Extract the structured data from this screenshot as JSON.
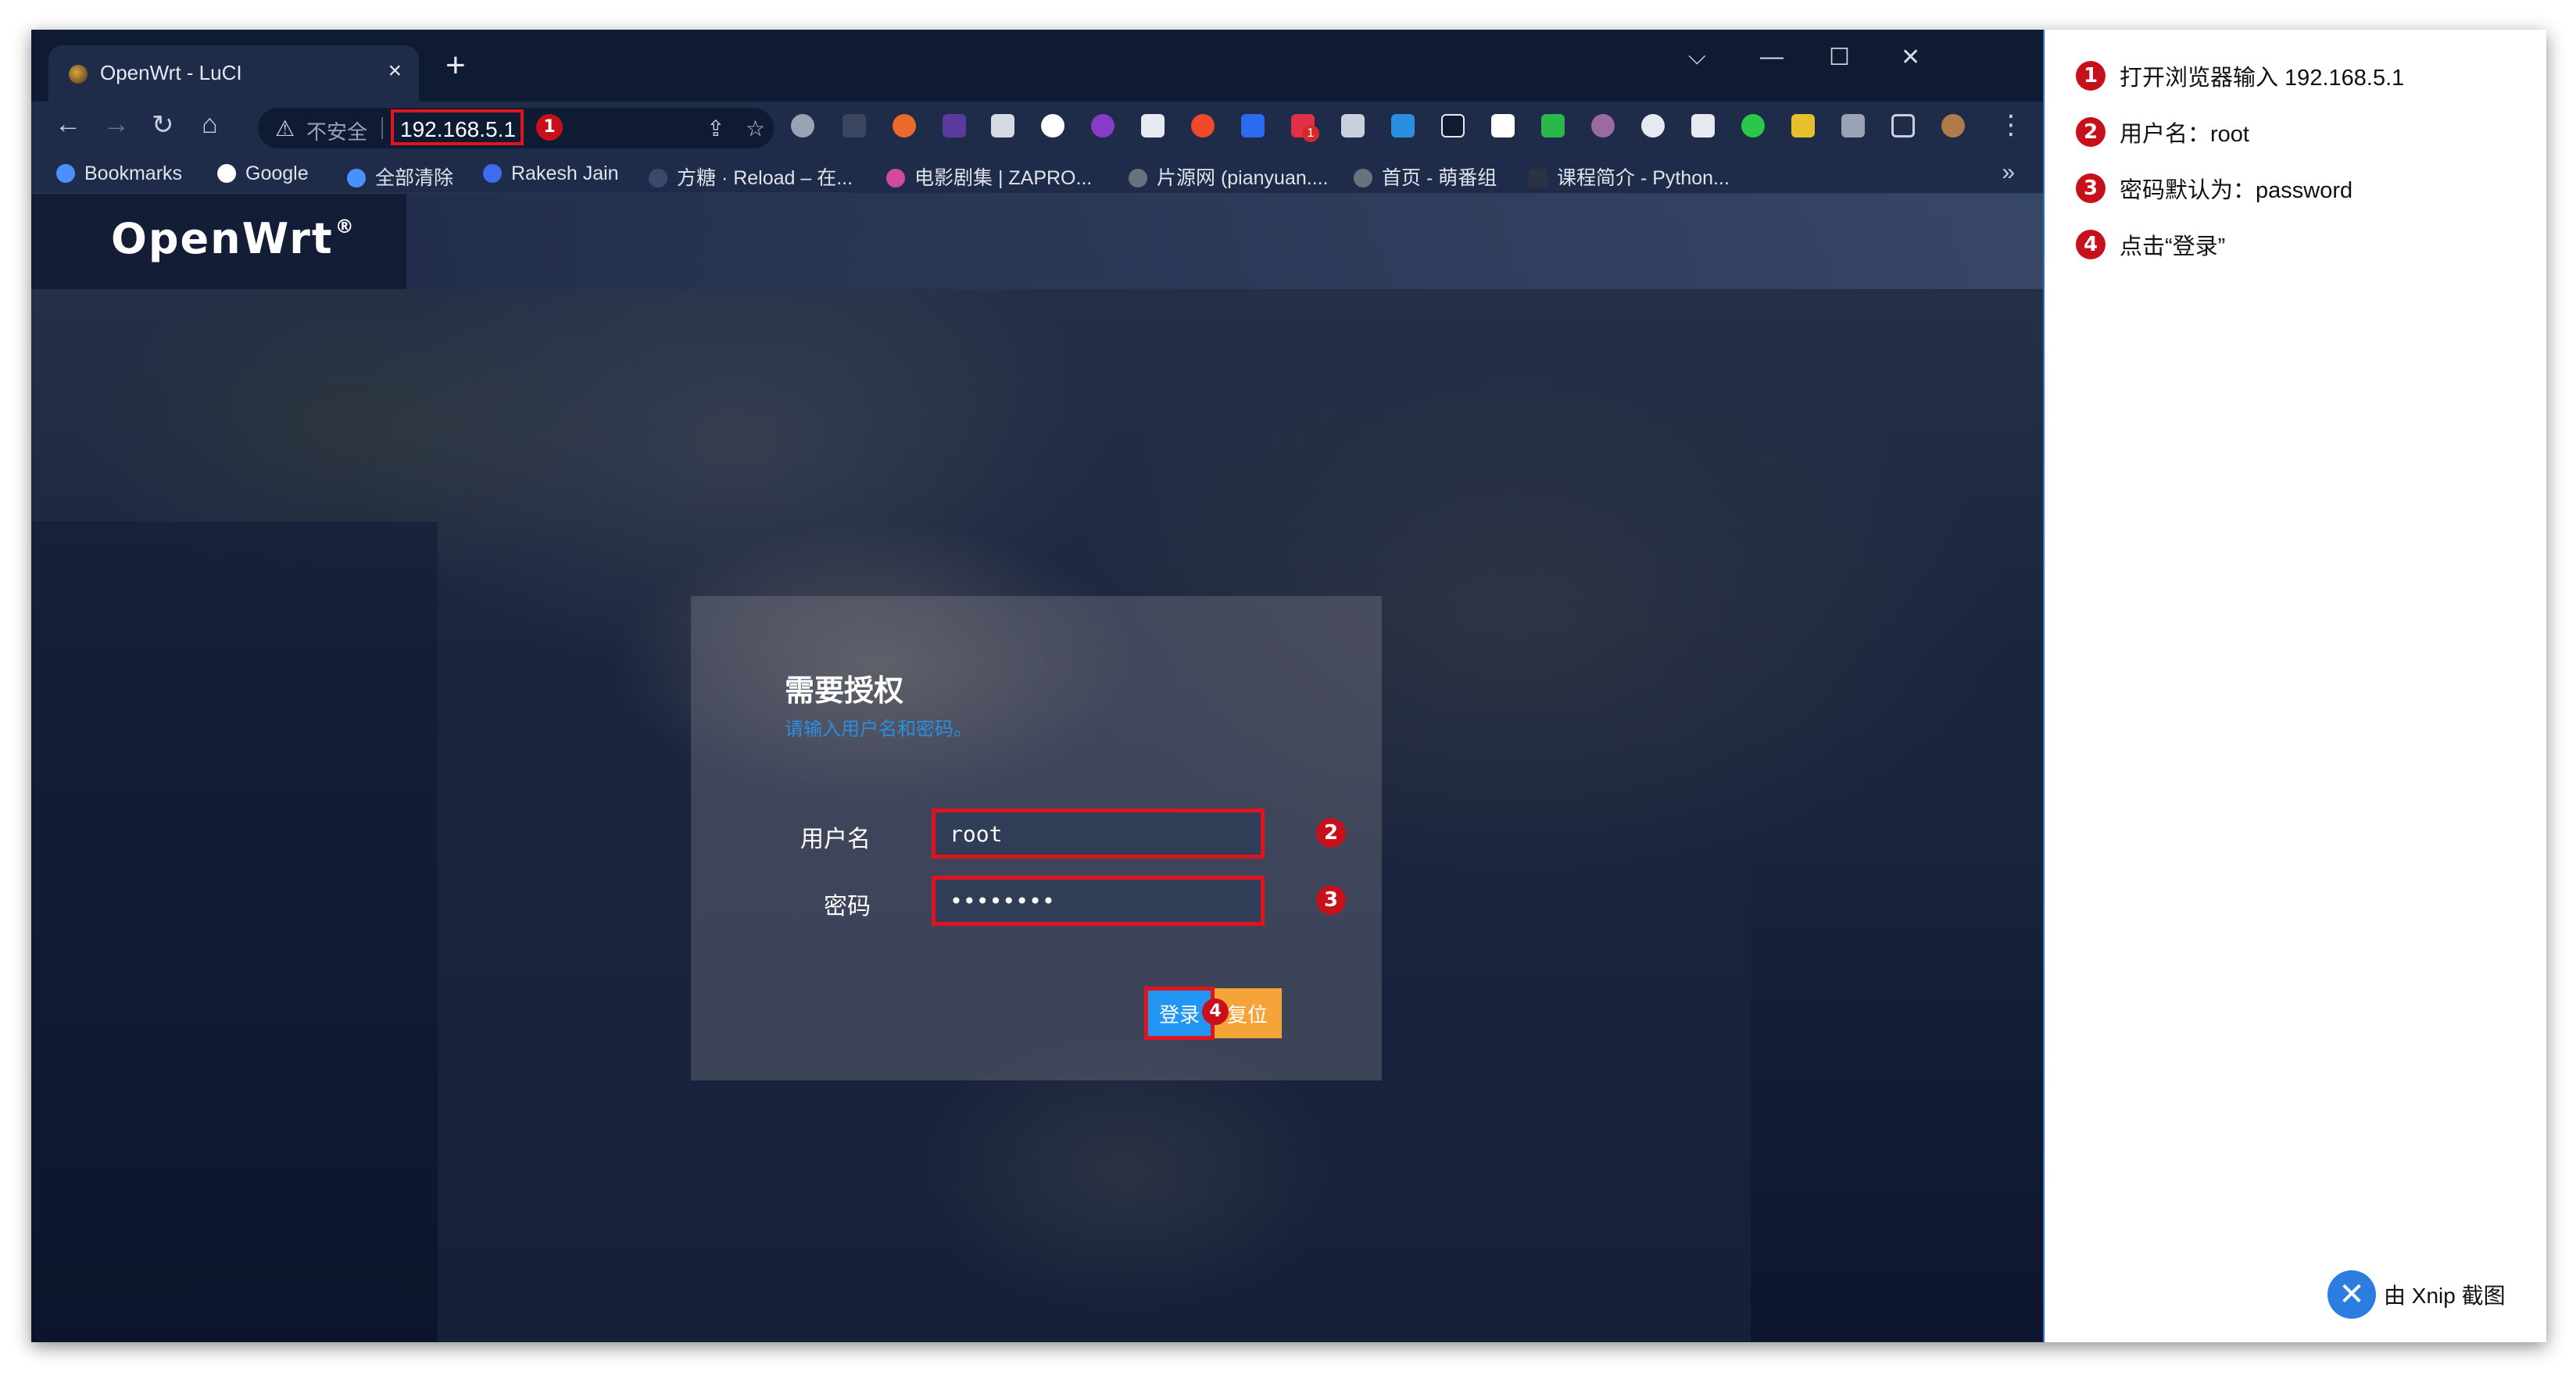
{
  "browser": {
    "tab_title": "OpenWrt - LuCI",
    "tab_close": "×",
    "new_tab": "+",
    "window_controls": {
      "dropdown": "⌵",
      "minimize": "—",
      "maximize": "☐",
      "close": "✕"
    },
    "nav": {
      "back": "←",
      "forward": "→",
      "reload": "↻",
      "home": "⌂"
    },
    "omnibox": {
      "security_text": "不安全",
      "url": "192.168.5.1",
      "share_icon": "⇪",
      "star_icon": "☆"
    },
    "menu": "⋮",
    "bookmarks": [
      {
        "label": "Bookmarks",
        "color": "#4a90ff"
      },
      {
        "label": "Google",
        "color": "#ffffff"
      },
      {
        "label": "全部清除",
        "color": "#4a90ff"
      },
      {
        "label": "Rakesh Jain",
        "color": "#3d6cf0"
      },
      {
        "label": "方糖 · Reload – 在...",
        "color": "#3a4a6a"
      },
      {
        "label": "电影剧集 | ZAPRO...",
        "color": "#d04aa0"
      },
      {
        "label": "片源网 (pianyuan....",
        "color": "#6a7280"
      },
      {
        "label": "首页 - 萌番组",
        "color": "#6a7280"
      },
      {
        "label": "课程简介 - Python...",
        "color": "#2a3244"
      }
    ],
    "bookmarks_more": "»"
  },
  "page": {
    "brand": "OpenWrt",
    "brand_mark": "®",
    "login": {
      "title": "需要授权",
      "subtitle": "请输入用户名和密码。",
      "username_label": "用户名",
      "username_value": "root",
      "password_label": "密码",
      "password_value": "password",
      "login_button": "登录",
      "reset_button": "复位"
    }
  },
  "badges": {
    "b1": "1",
    "b2": "2",
    "b3": "3",
    "b4": "4",
    "ext": "1"
  },
  "instructions": [
    {
      "num": "1",
      "text": "打开浏览器输入 192.168.5.1"
    },
    {
      "num": "2",
      "text": "用户名：root"
    },
    {
      "num": "3",
      "text": "密码默认为：password"
    },
    {
      "num": "4",
      "text": "点击“登录”"
    }
  ],
  "watermark": {
    "text": "由 Xnip 截图",
    "icon": "xnip-logo"
  },
  "colors": {
    "highlight": "#e0141e",
    "badge": "#c8101a",
    "login_blue": "#2196f3",
    "reset_orange": "#f5a43a"
  }
}
